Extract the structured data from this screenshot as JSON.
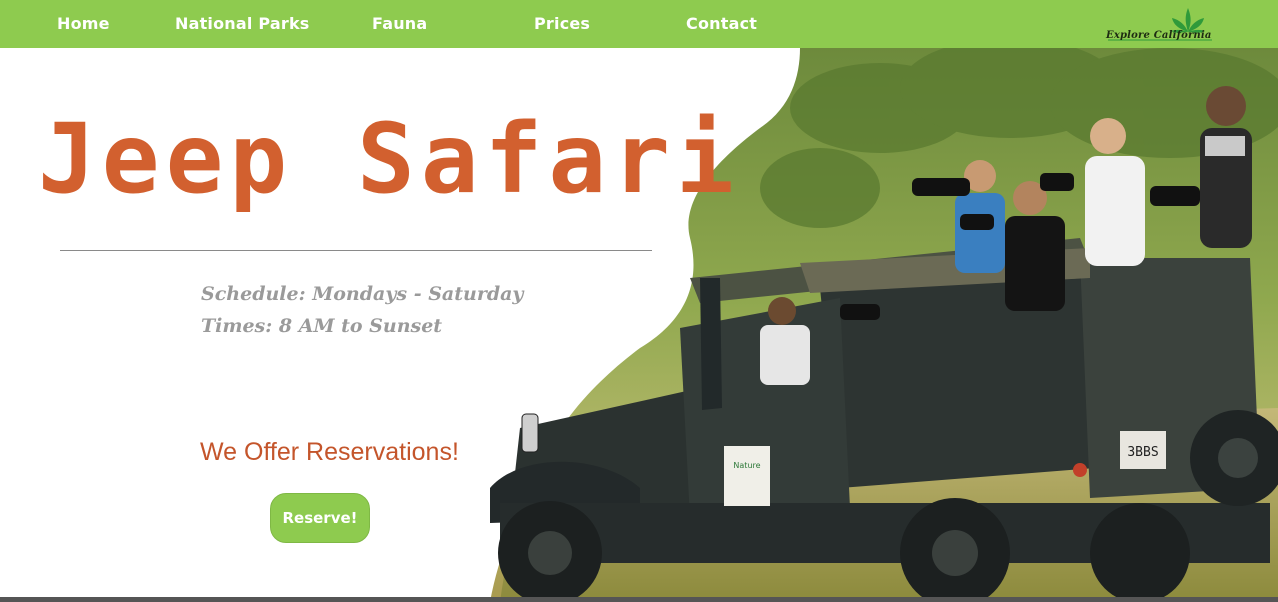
{
  "nav": {
    "items": [
      {
        "label": "Home"
      },
      {
        "label": "National Parks"
      },
      {
        "label": "Fauna"
      },
      {
        "label": "Prices"
      },
      {
        "label": "Contact"
      }
    ],
    "logo_text": "Explore California"
  },
  "hero": {
    "title": "Jeep Safari",
    "schedule": "Schedule: Mondays - Saturday",
    "times": "Times: 8 AM to Sunset",
    "offer": "We Offer Reservations!",
    "button_label": "Reserve!",
    "jeep_plate": "3BBS",
    "jeep_sign": "Nature"
  },
  "colors": {
    "accent_green": "#8ecb4f",
    "title_orange": "#d2602f",
    "offer_orange": "#c4552b",
    "info_gray": "#9a9a9a"
  },
  "photo": {
    "description_icon": "jeep-safari-photo"
  }
}
